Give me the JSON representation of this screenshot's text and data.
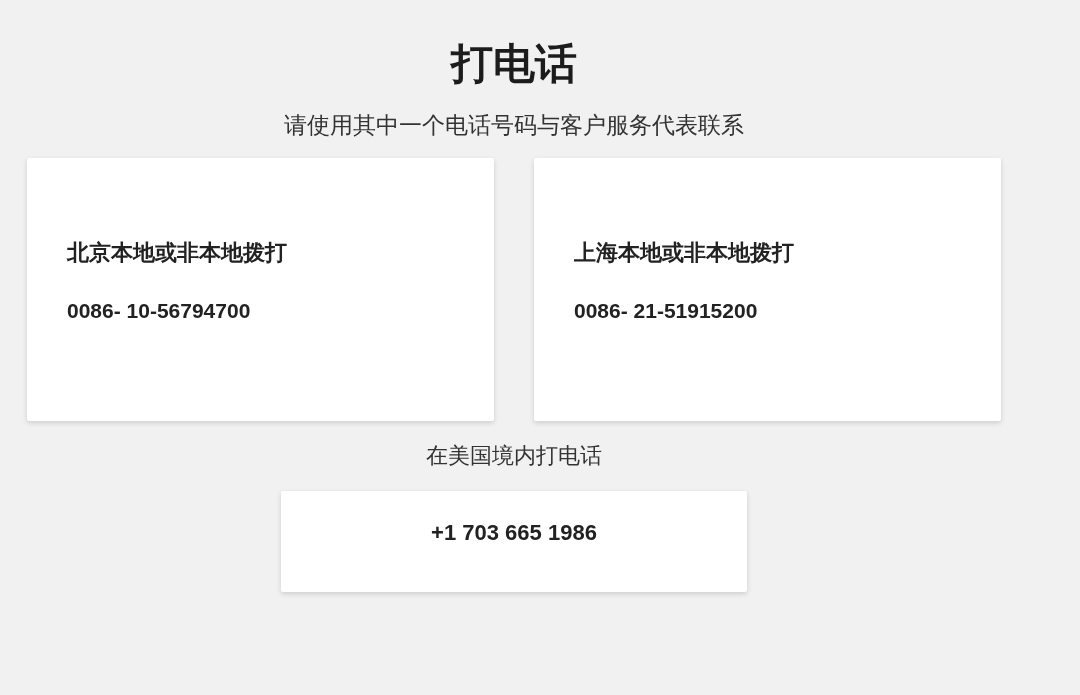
{
  "title": "打电话",
  "subtitle": "请使用其中一个电话号码与客户服务代表联系",
  "cards": [
    {
      "heading": "北京本地或非本地拨打",
      "phone": "0086- 10-56794700"
    },
    {
      "heading": "上海本地或非本地拨打",
      "phone": "0086- 21-51915200"
    }
  ],
  "us_section": {
    "label": "在美国境内打电话",
    "phone": "+1 703 665 1986"
  }
}
